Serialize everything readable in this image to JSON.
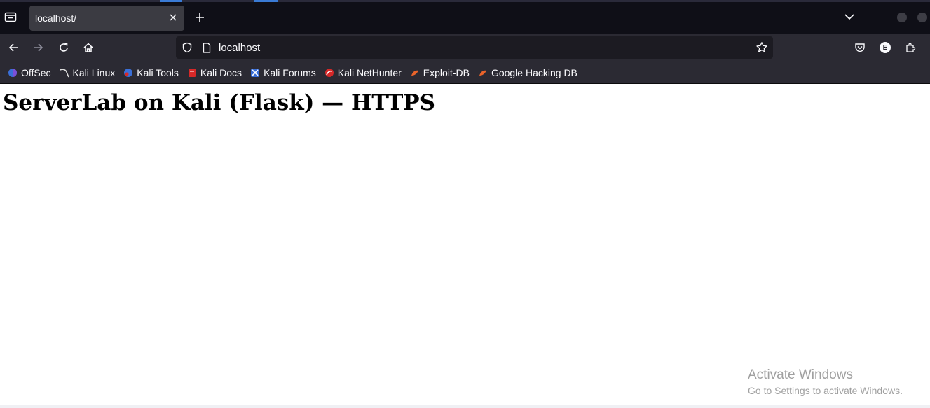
{
  "browser": {
    "tab": {
      "title": "localhost/"
    },
    "urlbar": {
      "url": "localhost"
    },
    "profile_initial": "E",
    "bookmarks": [
      {
        "label": "OffSec",
        "icon": "offsec-icon",
        "color": "#3a6fd8"
      },
      {
        "label": "Kali Linux",
        "icon": "kali-dragon-icon",
        "color": "#cccccc"
      },
      {
        "label": "Kali Tools",
        "icon": "kali-tools-icon",
        "color": "#3a6fd8"
      },
      {
        "label": "Kali Docs",
        "icon": "kali-docs-icon",
        "color": "#d62828"
      },
      {
        "label": "Kali Forums",
        "icon": "kali-forums-icon",
        "color": "#3a6fd8"
      },
      {
        "label": "Kali NetHunter",
        "icon": "nethunter-icon",
        "color": "#d62828"
      },
      {
        "label": "Exploit-DB",
        "icon": "exploit-db-icon",
        "color": "#e8632a"
      },
      {
        "label": "Google Hacking DB",
        "icon": "ghdb-icon",
        "color": "#e8632a"
      }
    ]
  },
  "page": {
    "heading": "ServerLab on Kali (Flask) — HTTPS"
  },
  "watermark": {
    "title": "Activate Windows",
    "subtitle": "Go to Settings to activate Windows."
  },
  "colors": {
    "tabbar_bg": "#0f0f17",
    "toolbar_bg": "#2b2a33",
    "urlbar_bg": "#1c1b22",
    "active_tab_bg": "#3b3b42",
    "text_light": "#fbfbfe"
  }
}
